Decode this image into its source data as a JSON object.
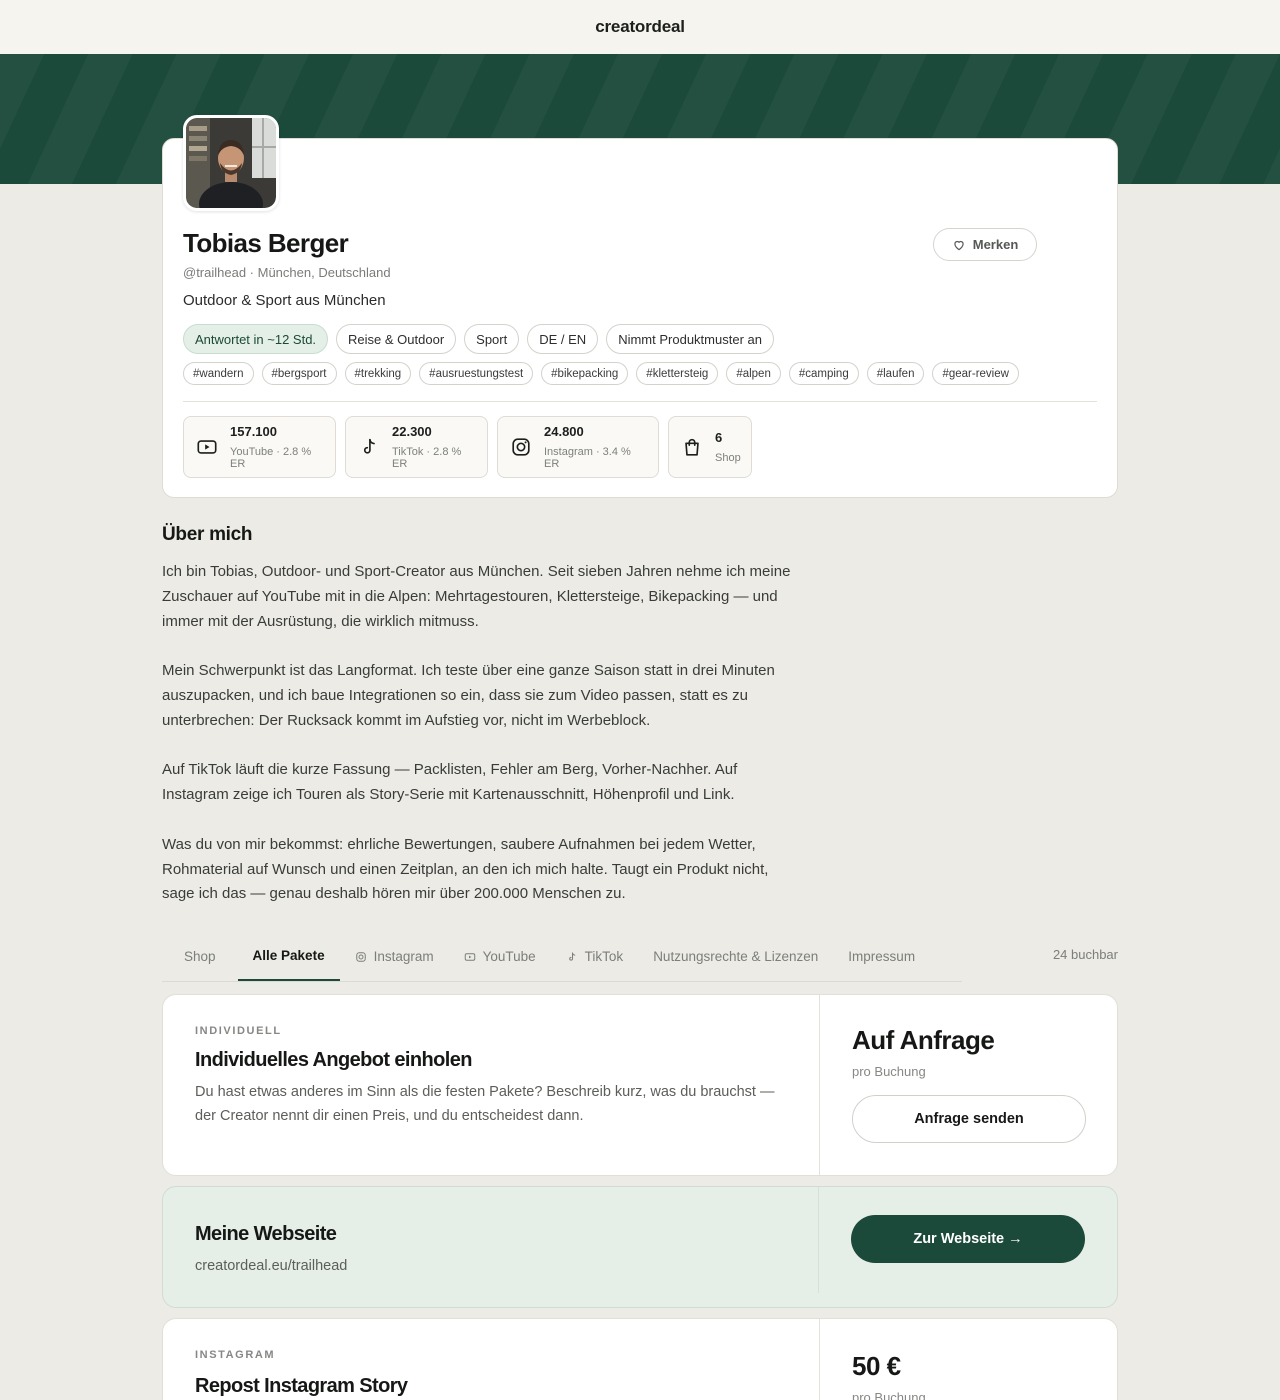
{
  "header": {
    "brand": "creatordeal"
  },
  "profile": {
    "name": "Tobias Berger",
    "handle_location": "@trailhead · München, Deutschland",
    "tagline": "Outdoor & Sport aus München",
    "save_button": "Merken",
    "chips": [
      "Antwortet in ~12 Std.",
      "Reise & Outdoor",
      "Sport",
      "DE / EN",
      "Nimmt Produktmuster an"
    ],
    "tags": [
      "#wandern",
      "#bergsport",
      "#trekking",
      "#ausruestungstest",
      "#bikepacking",
      "#klettersteig",
      "#alpen",
      "#camping",
      "#laufen",
      "#gear-review"
    ],
    "stats": [
      {
        "value": "157.100",
        "label": "YouTube · 2.8 % ER",
        "icon": "youtube-icon"
      },
      {
        "value": "22.300",
        "label": "TikTok · 2.8 % ER",
        "icon": "tiktok-icon"
      },
      {
        "value": "24.800",
        "label": "Instagram · 3.4 % ER",
        "icon": "instagram-icon"
      },
      {
        "value": "6",
        "label": "Shop",
        "icon": "shopping-bag-icon"
      }
    ]
  },
  "about": {
    "title": "Über mich",
    "paragraphs": [
      "Ich bin Tobias, Outdoor- und Sport-Creator aus München. Seit sieben Jahren nehme ich meine Zuschauer auf YouTube mit in die Alpen: Mehrtagestouren, Klettersteige, Bikepacking — und immer mit der Ausrüstung, die wirklich mitmuss.",
      "Mein Schwerpunkt ist das Langformat. Ich teste über eine ganze Saison statt in drei Minuten auszupacken, und ich baue Integrationen so ein, dass sie zum Video passen, statt es zu unterbrechen: Der Rucksack kommt im Aufstieg vor, nicht im Werbeblock.",
      "Auf TikTok läuft die kurze Fassung — Packlisten, Fehler am Berg, Vorher-Nachher. Auf Instagram zeige ich Touren als Story-Serie mit Kartenausschnitt, Höhenprofil und Link.",
      "Was du von mir bekommst: ehrliche Bewertungen, saubere Aufnahmen bei jedem Wetter, Rohmaterial auf Wunsch und einen Zeitplan, an den ich mich halte. Taugt ein Produkt nicht, sage ich das — genau deshalb hören mir über 200.000 Menschen zu."
    ]
  },
  "tabs": {
    "items": [
      "Shop",
      "Alle Pakete",
      "Instagram",
      "YouTube",
      "TikTok",
      "Nutzungsrechte & Lizenzen",
      "Impressum"
    ],
    "active": "Alle Pakete",
    "count": "24 buchbar"
  },
  "packages": [
    {
      "eyebrow": "INDIVIDUELL",
      "title": "Individuelles Angebot einholen",
      "description": "Du hast etwas anderes im Sinn als die festen Pakete? Beschreib kurz, was du brauchst — der Creator nennt dir einen Preis, und du entscheidest dann.",
      "price": "Auf Anfrage",
      "per": "pro Buchung",
      "button": "Anfrage senden"
    },
    {
      "eyebrow": "INSTAGRAM",
      "title": "Repost Instagram Story",
      "price": "50 €",
      "per": "pro Buchung"
    }
  ],
  "website": {
    "title": "Meine Webseite",
    "url": "creatordeal.eu/trailhead",
    "button": "Zur Webseite →"
  },
  "colors": {
    "brand_green": "#1c4a3a",
    "background": "#ecebe6",
    "chip_green": "#e3efe7"
  }
}
